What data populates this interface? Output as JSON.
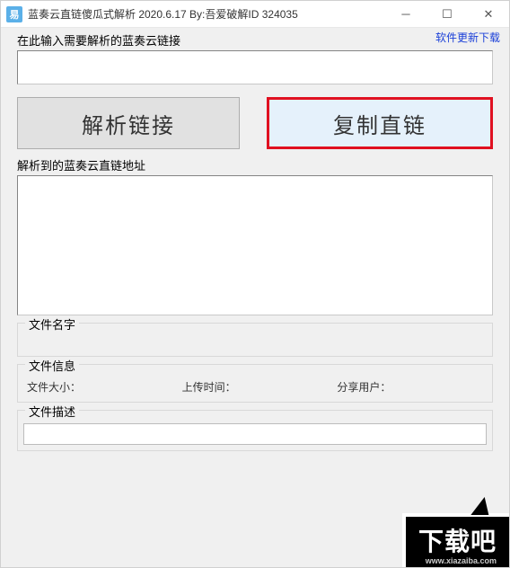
{
  "window": {
    "title": "蓝奏云直链傻瓜式解析  2020.6.17  By:吾爱破解ID  324035",
    "icon_letter": "易"
  },
  "update_link": "软件更新下载",
  "labels": {
    "input_url": "在此输入需要解析的蓝奏云链接",
    "result_addr": "解析到的蓝奏云直链地址"
  },
  "buttons": {
    "parse": "解析链接",
    "copy": "复制直链"
  },
  "groups": {
    "filename": "文件名字",
    "fileinfo": "文件信息",
    "filedesc": "文件描述"
  },
  "fileinfo": {
    "size_label": "文件大小：",
    "size_value": "",
    "time_label": "上传时间：",
    "time_value": "",
    "user_label": "分享用户：",
    "user_value": ""
  },
  "watermark": {
    "main": "下载吧",
    "sub": "www.xiazaiba.com"
  }
}
